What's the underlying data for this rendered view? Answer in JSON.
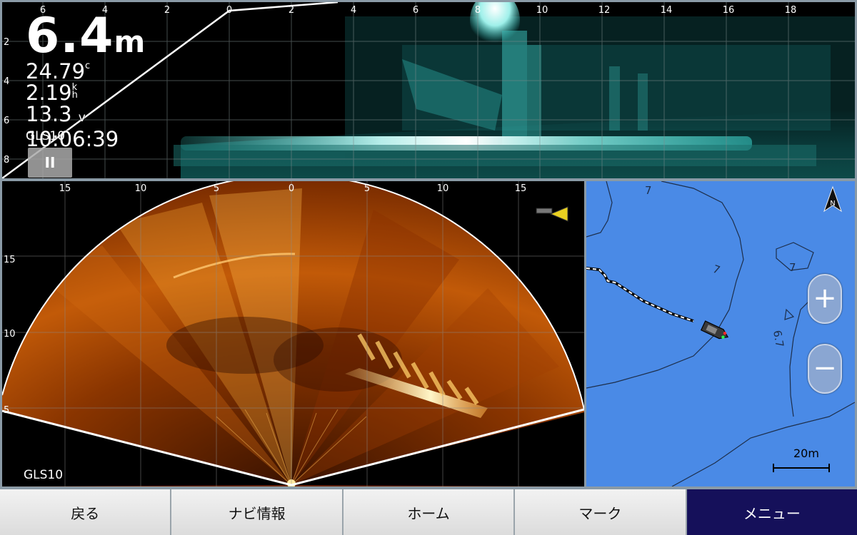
{
  "top_panel": {
    "x_ticks": [
      "6",
      "4",
      "2",
      "0",
      "2",
      "4",
      "6",
      "8",
      "10",
      "12",
      "14",
      "16",
      "18"
    ],
    "y_ticks": [
      "2",
      "4",
      "6",
      "8"
    ],
    "depth_value": "6.4",
    "depth_unit": "m",
    "water_temp": "24.79",
    "temp_unit": "c",
    "speed": "2.19",
    "speed_unit_top": "k",
    "speed_unit_bottom": "h",
    "voltage": "13.3",
    "voltage_unit": "v",
    "time": "10:06:39",
    "source_label": "GLS10",
    "pause_label": "II"
  },
  "sonar_panel": {
    "x_ticks": [
      "15",
      "10",
      "5",
      "0",
      "5",
      "10",
      "15"
    ],
    "y_ticks": [
      "15",
      "10",
      "5"
    ],
    "source_label": "GLS10"
  },
  "chart_panel": {
    "depth_labels": [
      "7",
      "7",
      "7",
      "6.7"
    ],
    "zoom_in_label": "+",
    "zoom_out_label": "−",
    "scale_label": "20m",
    "north_label": "N"
  },
  "menu": {
    "back": "戻る",
    "nav_info": "ナビ情報",
    "home": "ホーム",
    "mark": "マーク",
    "menu": "メニュー"
  },
  "colors": {
    "water": "#4a8ae6",
    "menu_active": "#15105a",
    "sonar_top_tint": "#3ee0d8",
    "sonar_fan_tint": "#f08a1a"
  }
}
